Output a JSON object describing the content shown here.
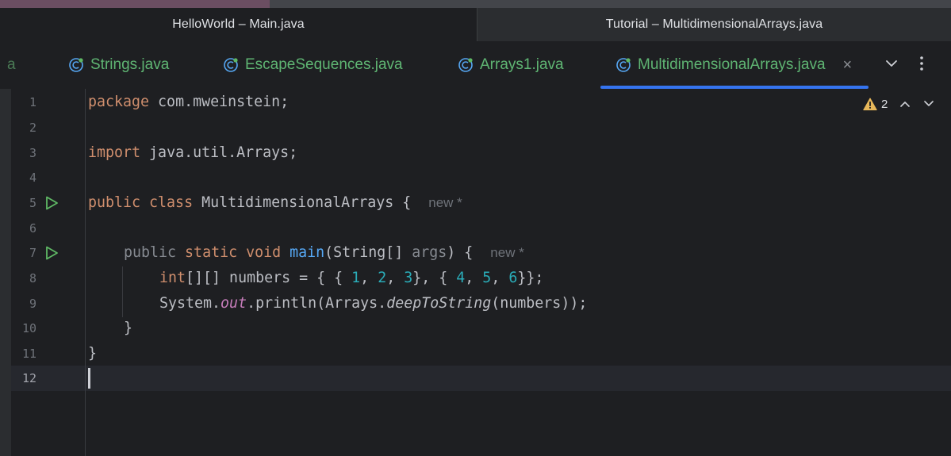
{
  "project_tabs": [
    {
      "label": "HelloWorld – Main.java",
      "active": false
    },
    {
      "label": "Tutorial – MultidimensionalArrays.java",
      "active": true
    }
  ],
  "editor_tabs": {
    "clipped_tab_fragment": "a",
    "tabs": [
      {
        "label": "Strings.java",
        "icon": "java-class-icon"
      },
      {
        "label": "EscapeSequences.java",
        "icon": "java-class-icon"
      },
      {
        "label": "Arrays1.java",
        "icon": "java-class-icon"
      },
      {
        "label": "MultidimensionalArrays.java",
        "icon": "java-class-icon",
        "active": true,
        "close": "×"
      }
    ],
    "overflow_icon": "chevron-down-icon",
    "more_icon": "more-vertical-icon"
  },
  "inspection": {
    "warning_count": "2",
    "icon": "warning-triangle-icon"
  },
  "editor": {
    "line_numbers": [
      "1",
      "2",
      "3",
      "4",
      "5",
      "6",
      "7",
      "8",
      "9",
      "10",
      "11",
      "12"
    ],
    "current_line": "12",
    "code": {
      "l1_kw": "package",
      "l1_rest": " com.mweinstein;",
      "l3_kw": "import",
      "l3_rest": " java.util.Arrays;",
      "l5_kw": "public class",
      "l5_rest": " MultidimensionalArrays {",
      "l5_hint": "new *",
      "l7_public": "public",
      "l7_kw": " static void ",
      "l7_fn": "main",
      "l7_mid": "(String[] ",
      "l7_param": "args",
      "l7_end": ") {",
      "l7_hint": "new *",
      "l8_kw": "int",
      "l8_a": "[][] numbers = { { ",
      "l8_n1": "1",
      "l8_c1": ", ",
      "l8_n2": "2",
      "l8_c2": ", ",
      "l8_n3": "3",
      "l8_b": "}, { ",
      "l8_n4": "4",
      "l8_c4": ", ",
      "l8_n5": "5",
      "l8_c5": ", ",
      "l8_n6": "6",
      "l8_end": "}};",
      "l9_a": "System.",
      "l9_field": "out",
      "l9_b": ".println(Arrays.",
      "l9_method": "deepToString",
      "l9_end": "(numbers));",
      "l10": "}",
      "l11": "}"
    }
  },
  "colors": {
    "background": "#1e1f22",
    "keyword": "#cf8e6d",
    "function": "#56a8f5",
    "number": "#2aacb8",
    "tab_text": "#5fb573",
    "active_tab_underline": "#3574f0",
    "run_icon": "#5fb865",
    "warning": "#e8b85a"
  }
}
